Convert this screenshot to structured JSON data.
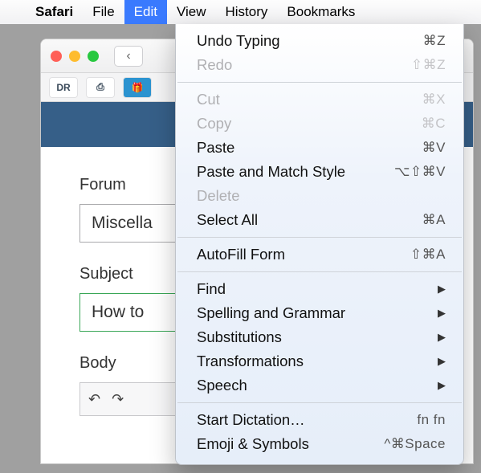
{
  "menubar": {
    "app": "Safari",
    "items": [
      "File",
      "Edit",
      "View",
      "History",
      "Bookmarks"
    ],
    "open_index": 1
  },
  "window": {
    "favicons": [
      "DR",
      "⎙",
      "🎁"
    ],
    "form": {
      "forum_label": "Forum",
      "forum_value": "Miscella",
      "subject_label": "Subject",
      "subject_value": "How to",
      "body_label": "Body"
    }
  },
  "edit_menu": [
    {
      "label": "Undo Typing",
      "shortcut": "⌘Z"
    },
    {
      "label": "Redo",
      "shortcut": "⇧⌘Z",
      "disabled": true
    },
    {
      "sep": true
    },
    {
      "label": "Cut",
      "shortcut": "⌘X",
      "disabled": true
    },
    {
      "label": "Copy",
      "shortcut": "⌘C",
      "disabled": true
    },
    {
      "label": "Paste",
      "shortcut": "⌘V"
    },
    {
      "label": "Paste and Match Style",
      "shortcut": "⌥⇧⌘V"
    },
    {
      "label": "Delete",
      "disabled": true
    },
    {
      "label": "Select All",
      "shortcut": "⌘A"
    },
    {
      "sep": true
    },
    {
      "label": "AutoFill Form",
      "shortcut": "⇧⌘A"
    },
    {
      "sep": true
    },
    {
      "label": "Find",
      "submenu": true
    },
    {
      "label": "Spelling and Grammar",
      "submenu": true
    },
    {
      "label": "Substitutions",
      "submenu": true
    },
    {
      "label": "Transformations",
      "submenu": true
    },
    {
      "label": "Speech",
      "submenu": true
    },
    {
      "sep": true
    },
    {
      "label": "Start Dictation…",
      "shortcut": "fn fn"
    },
    {
      "label": "Emoji & Symbols",
      "shortcut": "^⌘Space"
    }
  ]
}
